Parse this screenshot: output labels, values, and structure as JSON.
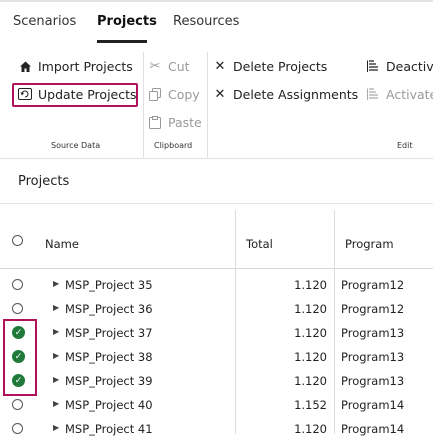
{
  "tabs": [
    {
      "label": "Scenarios"
    },
    {
      "label": "Projects"
    },
    {
      "label": "Resources"
    }
  ],
  "ribbon": {
    "source_data": {
      "import_label": "Import Projects",
      "update_label": "Update Projects",
      "group_label": "Source Data"
    },
    "clipboard": {
      "cut_label": "Cut",
      "copy_label": "Copy",
      "paste_label": "Paste",
      "group_label": "Clipboard"
    },
    "edit": {
      "delete_projects_label": "Delete Projects",
      "delete_assignments_label": "Delete Assignments",
      "deactivate_label": "Deactiv",
      "activate_label": "Activate",
      "group_label": "Edit"
    }
  },
  "panel": {
    "title": "Projects"
  },
  "table": {
    "headers": {
      "name": "Name",
      "total": "Total",
      "program": "Program"
    },
    "rows": [
      {
        "name": "MSP_Project 35",
        "total": "1.120",
        "program": "Program12",
        "checked": false
      },
      {
        "name": "MSP_Project 36",
        "total": "1.120",
        "program": "Program12",
        "checked": false
      },
      {
        "name": "MSP_Project 37",
        "total": "1.120",
        "program": "Program13",
        "checked": true
      },
      {
        "name": "MSP_Project 38",
        "total": "1.120",
        "program": "Program13",
        "checked": true
      },
      {
        "name": "MSP_Project 39",
        "total": "1.120",
        "program": "Program13",
        "checked": true
      },
      {
        "name": "MSP_Project 40",
        "total": "1.152",
        "program": "Program14",
        "checked": false
      },
      {
        "name": "MSP_Project 41",
        "total": "1.120",
        "program": "Program14",
        "checked": false
      }
    ]
  },
  "colors": {
    "highlight": "#b0135b",
    "check_green": "#1f7a3a"
  }
}
